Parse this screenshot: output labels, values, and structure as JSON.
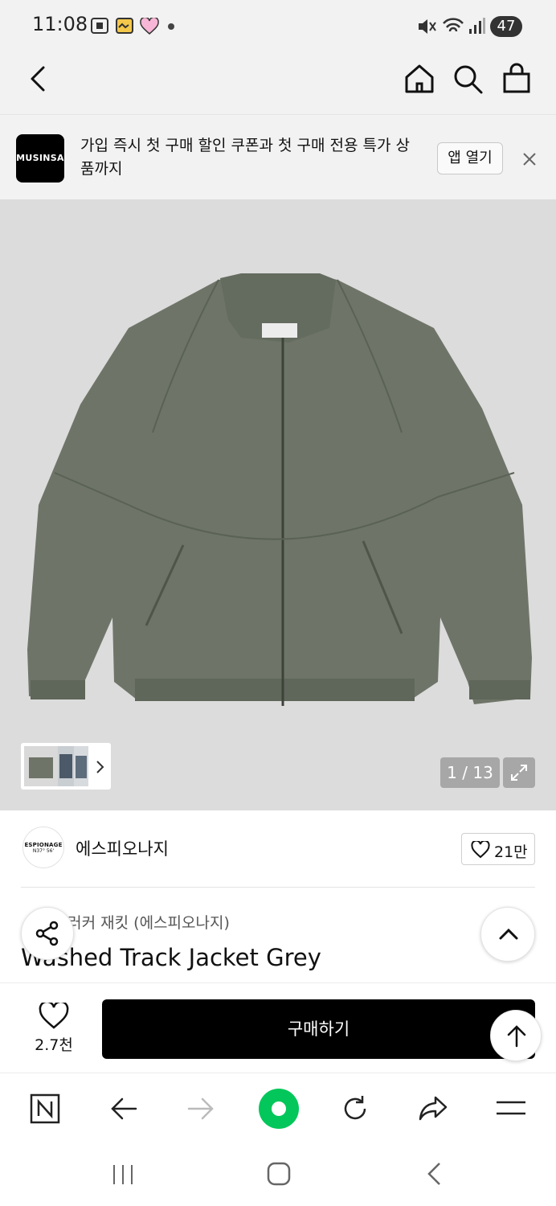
{
  "status_bar": {
    "time": "11:08",
    "battery": "47"
  },
  "header": {
    "icons": [
      "back-icon",
      "home-icon",
      "search-icon",
      "shopping-bag-icon"
    ]
  },
  "app_banner": {
    "logo_text": "MUSINSA",
    "message": "가입 즉시 첫 구매 할인 쿠폰과 첫 구매 전용 특가 상품까지",
    "open_app_label": "앱 열기"
  },
  "gallery": {
    "counter": "1 / 13"
  },
  "brand": {
    "logo_text": "ESPIONAGE",
    "logo_sub": "N37° 56'",
    "name": "에스피오나지",
    "like_count": "21만"
  },
  "product": {
    "breadcrumb_prefix": "…",
    "breadcrumb": "› 트러커 재킷 (에스피오나지)",
    "title": "Washed Track Jacket Grey"
  },
  "purchase_bar": {
    "wish_count": "2.7천",
    "buy_label": "구매하기"
  },
  "colors": {
    "brand_black": "#000000",
    "naver_green": "#03c75a",
    "jacket_green_grey": "#6e7568"
  }
}
